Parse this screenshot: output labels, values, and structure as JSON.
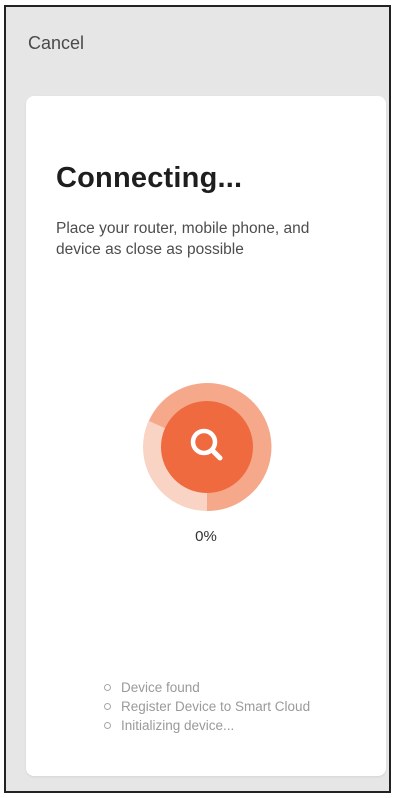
{
  "header": {
    "cancel_label": "Cancel"
  },
  "card": {
    "title": "Connecting...",
    "description": "Place your router, mobile phone, and device as close as possible",
    "progress": {
      "percent_text": "0%",
      "value": 0,
      "icon": "search-icon"
    },
    "steps": [
      {
        "label": "Device found"
      },
      {
        "label": "Register Device to Smart Cloud"
      },
      {
        "label": "Initializing device..."
      }
    ]
  },
  "colors": {
    "accent": "#ef6a3f",
    "accent_light": "#f5a98a",
    "accent_pale": "#f9d3c3",
    "background": "#e6e6e6",
    "card": "#ffffff",
    "title_text": "#1e1e1e",
    "muted_text": "#9a9a9a"
  }
}
